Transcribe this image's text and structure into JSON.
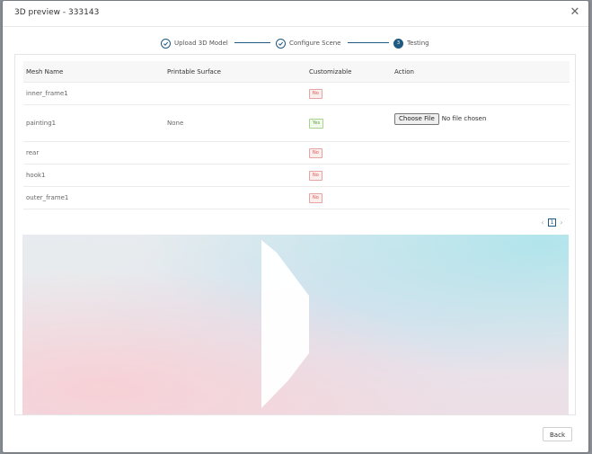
{
  "modal": {
    "title": "3D preview - 333143",
    "close_glyph": "✕"
  },
  "steps": [
    {
      "label": "Upload 3D Model",
      "state": "done"
    },
    {
      "label": "Configure Scene",
      "state": "done"
    },
    {
      "label": "Testing",
      "state": "active",
      "number": "3"
    }
  ],
  "table": {
    "headers": [
      "Mesh Name",
      "Printable Surface",
      "Customizable",
      "Action"
    ],
    "rows": [
      {
        "mesh": "inner_frame1",
        "surface": "",
        "customizable": "No"
      },
      {
        "mesh": "painting1",
        "surface": "None",
        "customizable": "Yes",
        "file_button": "Choose File",
        "file_status": "No file chosen"
      },
      {
        "mesh": "rear",
        "surface": "",
        "customizable": "No"
      },
      {
        "mesh": "hook1",
        "surface": "",
        "customizable": "No"
      },
      {
        "mesh": "outer_frame1",
        "surface": "",
        "customizable": "No"
      }
    ]
  },
  "pagination": {
    "prev": "‹",
    "current": "1",
    "next": "›"
  },
  "footer": {
    "back_label": "Back"
  },
  "colors": {
    "accent": "#1f5a82",
    "badge_no": "#d9534f",
    "badge_yes": "#5a9e37"
  }
}
